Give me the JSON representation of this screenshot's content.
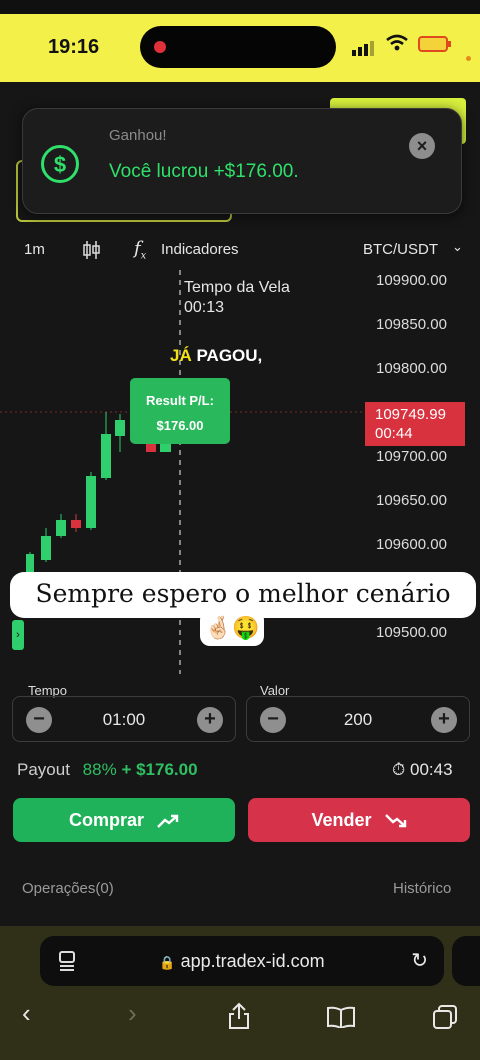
{
  "status": {
    "time": "19:16"
  },
  "toast": {
    "title": "Ganhou!",
    "message": "Você lucrou +$176.00."
  },
  "toolbar": {
    "timeframe": "1m",
    "indicators": "Indicadores",
    "pair": "BTC/USDT"
  },
  "chart": {
    "price_labels": [
      "109900.00",
      "109850.00",
      "109800.00",
      "109700.00",
      "109650.00",
      "109600.00",
      "109500.00"
    ],
    "current_price": "109749.99",
    "current_countdown": "00:44",
    "candle_time_label": "Tempo da Vela",
    "candle_time_value": "00:13",
    "result_label": "Result P/L:",
    "result_value": "$176.00"
  },
  "overlay": {
    "ja": "JÁ",
    "pagou": "PAGOU,",
    "caption": "Sempre espero o melhor cenário",
    "emojis": "🤞🏻🤑"
  },
  "controls": {
    "time_label": "Tempo",
    "time_value": "01:00",
    "value_label": "Valor",
    "value_value": "200",
    "payout_label": "Payout",
    "payout_percent": "88%",
    "payout_amount": "+ $176.00",
    "timer": "00:43",
    "buy_label": "Comprar",
    "sell_label": "Vender",
    "operations_tab": "Operações(0)",
    "history_tab": "Histórico"
  },
  "browser": {
    "url": "app.tradex-id.com"
  },
  "colors": {
    "accent_green": "#2fbf63",
    "sell_red": "#d6334a",
    "status_yellow": "#f3f04a"
  }
}
